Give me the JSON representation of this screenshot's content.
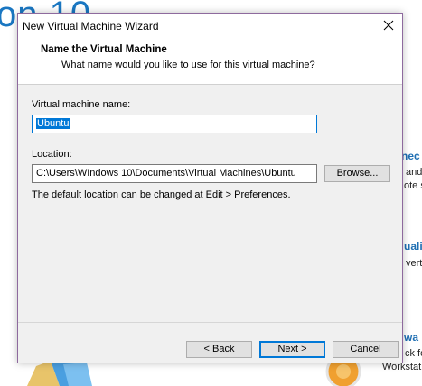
{
  "background": {
    "big_text": "on 10",
    "right_fragments": [
      {
        "text": "nec",
        "style": "blue"
      },
      {
        "text": "and",
        "style": "plain"
      },
      {
        "text": "ote s",
        "style": "plain"
      },
      {
        "text": "uali",
        "style": "blue"
      },
      {
        "text": "vert",
        "style": "plain"
      },
      {
        "text": "wa",
        "style": "blue"
      },
      {
        "text": "ck fo",
        "style": "plain"
      },
      {
        "text": "Workstat",
        "style": "plain"
      }
    ]
  },
  "dialog": {
    "title": "New Virtual Machine Wizard",
    "header": {
      "title": "Name the Virtual Machine",
      "subtitle": "What name would you like to use for this virtual machine?"
    },
    "vm_name": {
      "label": "Virtual machine name:",
      "value": "Ubuntu"
    },
    "location": {
      "label": "Location:",
      "value": "C:\\Users\\WIndows 10\\Documents\\Virtual Machines\\Ubuntu",
      "browse_label": "Browse..."
    },
    "hint": "The default location can be changed at Edit > Preferences.",
    "buttons": {
      "back": "< Back",
      "next": "Next >",
      "cancel": "Cancel"
    }
  },
  "colors": {
    "accent": "#0078d7",
    "dialog_bg": "#f0f0f0",
    "dialog_border": "#8e6a9e",
    "background_brand": "#1a77c2"
  }
}
